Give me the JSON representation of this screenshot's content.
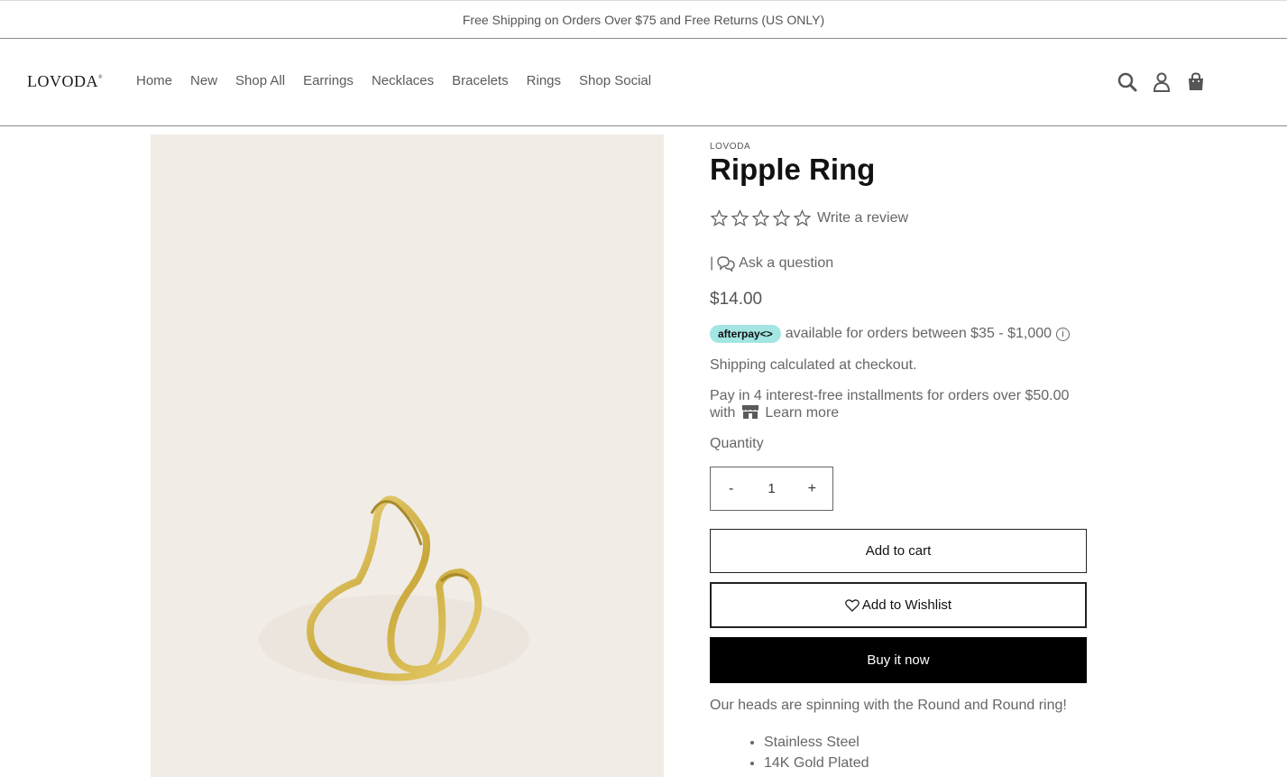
{
  "announcement": "Free Shipping on Orders Over $75 and Free Returns (US ONLY)",
  "header": {
    "logo": "LOVODA",
    "nav": [
      "Home",
      "New",
      "Shop All",
      "Earrings",
      "Necklaces",
      "Bracelets",
      "Rings",
      "Shop Social"
    ],
    "icons": [
      "search-icon",
      "account-icon",
      "cart-bag-icon"
    ]
  },
  "product": {
    "vendor": "LOVODA",
    "title": "Ripple Ring",
    "rating_stars": 0,
    "write_review": "Write a review",
    "ask_prefix": "|",
    "ask_question": "Ask a question",
    "price": "$14.00",
    "afterpay": {
      "badge": "afterpay<>",
      "text": "available for orders between $35 - $1,000",
      "info": "ⓘ"
    },
    "shipping": "Shipping calculated at checkout.",
    "installments": {
      "text": "Pay in 4 interest-free installments for orders over $50.00 with",
      "learn_more": "Learn more"
    },
    "quantity_label": "Quantity",
    "quantity": {
      "minus": "-",
      "value": "1",
      "plus": "+"
    },
    "add_to_cart": "Add to cart",
    "add_to_wishlist": "Add to Wishlist",
    "buy_now": "Buy it now",
    "description": "Our heads are spinning with the Round and Round ring!",
    "features": [
      "Stainless Steel",
      "14K Gold Plated"
    ]
  },
  "colors": {
    "afterpay_badge": "#a3e6e3",
    "buy_button": "#000000",
    "image_bg": "#f2ece6",
    "gold": "#d9b94a"
  }
}
